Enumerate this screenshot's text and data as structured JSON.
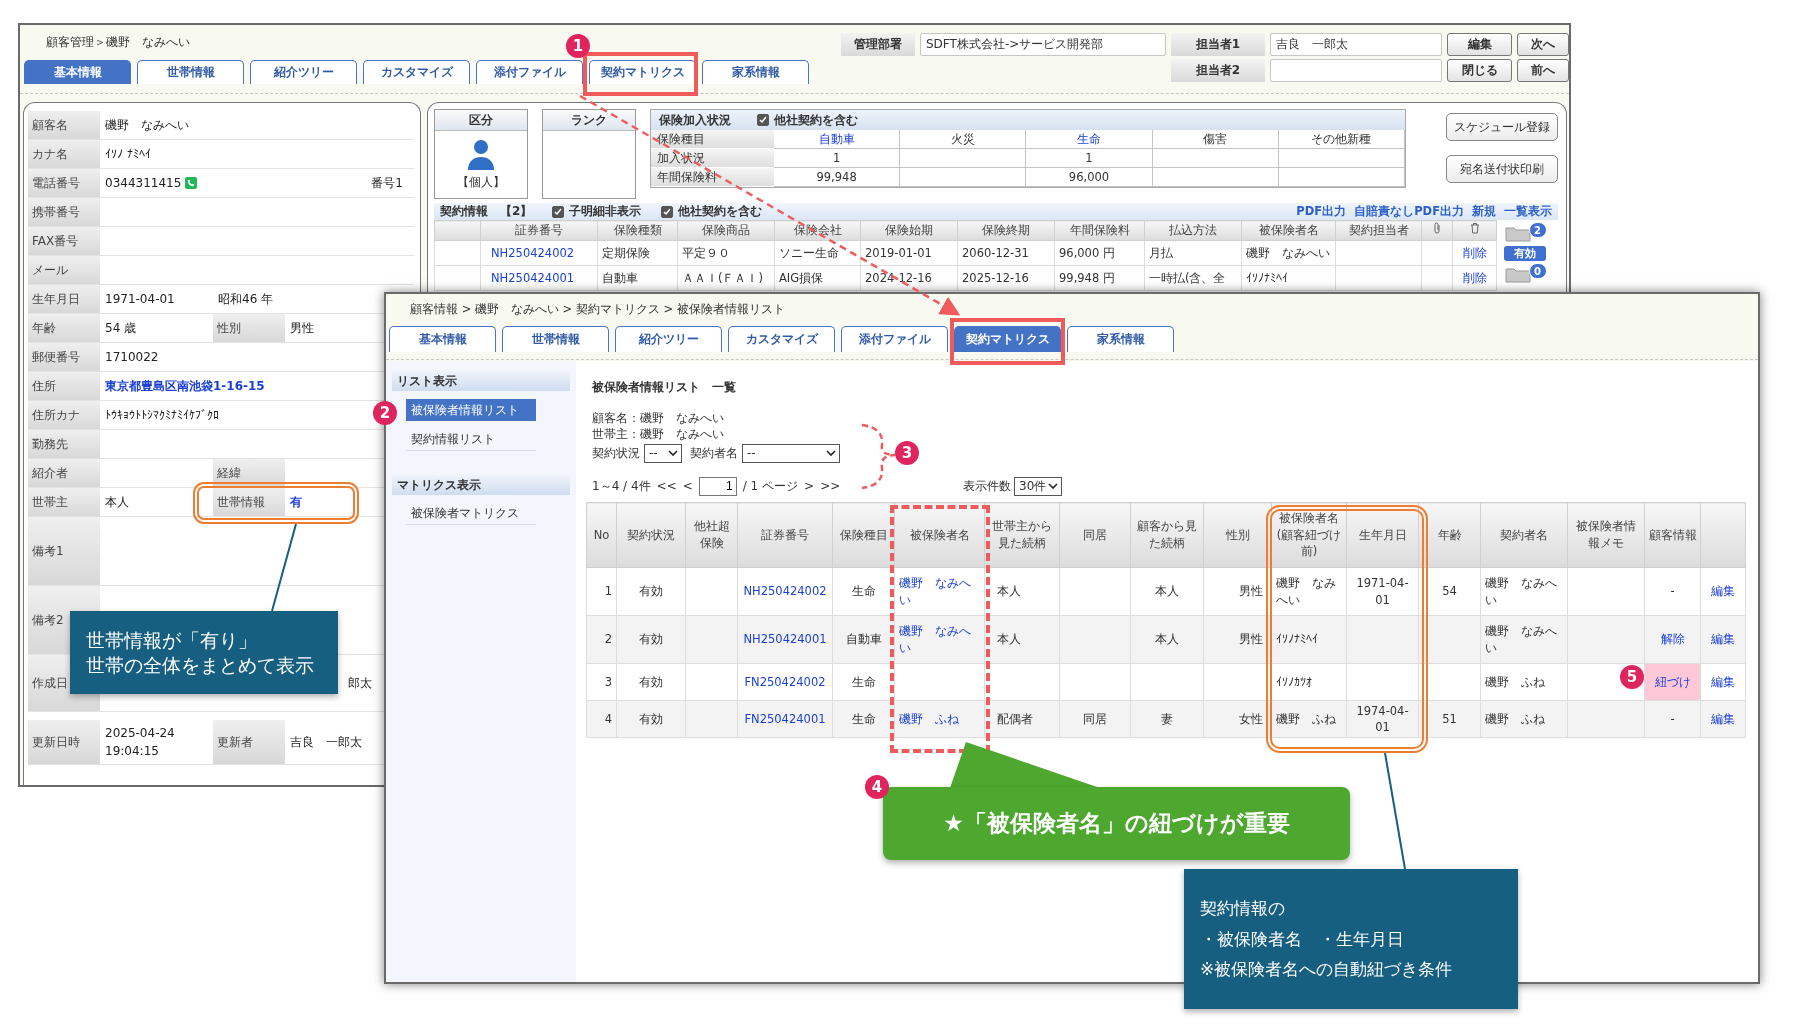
{
  "back_window": {
    "breadcrumb": "顧客管理＞磯野　なみへい",
    "header_fields": [
      {
        "label": "管理部署",
        "value": "SDFT株式会社->サービス開発部"
      },
      {
        "label": "担当者1",
        "value": "吉良　一郎太"
      },
      {
        "label": "担当者2"
      }
    ],
    "buttons": [
      "編集",
      "次へ",
      "閉じる",
      "前へ"
    ],
    "tabs": [
      {
        "label": "基本情報",
        "selected": true
      },
      {
        "label": "世帯情報",
        "selected": false
      },
      {
        "label": "紹介ツリー",
        "selected": false
      },
      {
        "label": "カスタマイズ",
        "selected": false
      },
      {
        "label": "添付ファイル",
        "selected": false
      },
      {
        "label": "契約マトリクス",
        "selected": false
      },
      {
        "label": "家系情報",
        "selected": false
      }
    ],
    "customer_rows": [
      {
        "kind": "text",
        "label": "顧客名",
        "value": "磯野　なみへい"
      },
      {
        "kind": "text",
        "label": "カナ名",
        "value": "ｲｿﾉ ﾅﾐﾍｲ"
      },
      {
        "kind": "phone",
        "label": "電話番号",
        "value": "0344311415",
        "extra": "番号1"
      },
      {
        "kind": "text",
        "label": "携帯番号"
      },
      {
        "kind": "text",
        "label": "FAX番号"
      },
      {
        "kind": "text",
        "label": "メール"
      },
      {
        "kind": "era",
        "label": "生年月日",
        "value": "1971-04-01",
        "extra": "昭和46 年"
      },
      {
        "kind": "pair",
        "cells": [
          {
            "label": "年齢",
            "value": "54 歳",
            "link": false
          },
          {
            "label": "性別",
            "value": "男性",
            "link": false
          }
        ]
      },
      {
        "kind": "text",
        "label": "郵便番号",
        "value": "1710022"
      },
      {
        "kind": "link",
        "label": "住所",
        "value": "東京都豊島区南池袋1-16-15"
      },
      {
        "kind": "text",
        "label": "住所カナ",
        "value": "ﾄｳｷｮｳﾄﾄｼﾏｸﾐﾅﾐｲｹﾌﾞｸﾛ"
      },
      {
        "kind": "text",
        "label": "勤務先"
      },
      {
        "kind": "pair",
        "cells": [
          {
            "label": "紹介者"
          },
          {
            "label": "経緯"
          }
        ]
      },
      {
        "kind": "pair",
        "cells": [
          {
            "label": "世帯主",
            "value": "本人",
            "link": false
          },
          {
            "label": "世帯情報",
            "value": "有",
            "link": true
          }
        ]
      },
      {
        "kind": "memo",
        "label": "備考1"
      },
      {
        "kind": "memo",
        "label": "備考2"
      },
      {
        "kind": "footer",
        "cells": [
          {
            "label": "作成日"
          },
          {
            "value": "郎太",
            "link": false
          }
        ]
      },
      {
        "kind": "footer",
        "cells": [
          {
            "label": "更新日時",
            "value": "2025-04-24 19:04:15",
            "link": false
          },
          {
            "label": "更新者",
            "value": "吉良　一郎太",
            "link": false
          }
        ]
      }
    ],
    "class_box": {
      "title": "区分",
      "value": "【個人】"
    },
    "rank_box": {
      "title": "ランク"
    },
    "coverage": {
      "title": "保険加入状況",
      "include_other": {
        "label": "他社契約を含む",
        "checked": true
      },
      "row_labels": [
        "保険種目",
        "加入状況",
        "年間保険料"
      ],
      "columns": [
        {
          "name": "自動車",
          "link": true,
          "count": "1",
          "premium": "99,948"
        },
        {
          "name": "火災",
          "link": false
        },
        {
          "name": "生命",
          "link": true,
          "count": "1",
          "premium": "96,000"
        },
        {
          "name": "傷害",
          "link": false
        },
        {
          "name": "その他新種",
          "link": false
        }
      ]
    },
    "side_buttons": [
      "スケジュール登録",
      "宛名送付状印刷"
    ],
    "contracts": {
      "title": "契約情報　【2】",
      "options": [
        {
          "label": "子明細非表示",
          "checked": true
        },
        {
          "label": "他社契約を含む",
          "checked": true
        }
      ],
      "links": [
        "PDF出力",
        "自賠責なしPDF出力",
        "新規",
        "一覧表示"
      ],
      "columns": [
        "証券番号",
        "保険種類",
        "保険商品",
        "保険会社",
        "保険始期",
        "保険終期",
        "年間保険料",
        "払込方法",
        "被保険者名",
        "契約担当者"
      ],
      "rows": [
        {
          "cells": [
            "NH250424002",
            "定期保険",
            "平定９０",
            "ソニー生命",
            "2019-01-01",
            "2060-12-31",
            "96,000 円",
            "月払",
            "磯野　なみへい",
            ""
          ],
          "action": "削除",
          "files": "2",
          "status": "有効"
        },
        {
          "cells": [
            "NH250424001",
            "自動車",
            "ＡＡＩ(ＦＡＩ)",
            "AIG損保",
            "2024-12-16",
            "2025-12-16",
            "99,948 円",
            "一時払(含、全",
            "ｲｿﾉﾅﾐﾍｲ",
            ""
          ],
          "action": "削除",
          "files": "0"
        }
      ]
    }
  },
  "front_window": {
    "breadcrumb": "顧客情報 > 磯野　なみへい > 契約マトリクス > 被保険者情報リスト",
    "tabs": [
      {
        "label": "基本情報",
        "selected": false
      },
      {
        "label": "世帯情報",
        "selected": false
      },
      {
        "label": "紹介ツリー",
        "selected": false
      },
      {
        "label": "カスタマイズ",
        "selected": false
      },
      {
        "label": "添付ファイル",
        "selected": false
      },
      {
        "label": "契約マトリクス",
        "selected": true
      },
      {
        "label": "家系情報",
        "selected": false
      }
    ],
    "sidebar": [
      {
        "title": "リスト表示",
        "items": [
          {
            "label": "被保険者情報リスト",
            "selected": true
          },
          {
            "label": "契約情報リスト",
            "selected": false
          }
        ]
      },
      {
        "title": "マトリクス表示",
        "items": [
          {
            "label": "被保険者マトリクス",
            "selected": false
          }
        ]
      }
    ],
    "title": "被保険者情報リスト　一覧",
    "info": [
      "顧客名：磯野　なみへい",
      "世帯主：磯野　なみへい"
    ],
    "filters": [
      {
        "label": "契約状況",
        "value": "--"
      },
      {
        "label": "契約者名",
        "value": "--"
      }
    ],
    "pagination": {
      "range": "1～4 / 4件",
      "first": "<<",
      "prev": "<",
      "page": "1",
      "total": "/ 1 ページ",
      "next": ">",
      "last": ">>"
    },
    "page_size": {
      "label": "表示件数",
      "value": "30件"
    },
    "columns": [
      "No",
      "契約状況",
      "他社超保険",
      "証券番号",
      "保険種目",
      "被保険者名",
      "世帯主から見た続柄",
      "同居",
      "顧客から見た続柄",
      "性別",
      "被保険者名(顧客紐づけ前)",
      "生年月日",
      "年齢",
      "契約者名",
      "被保険者情報メモ",
      "顧客情報"
    ],
    "rows": [
      {
        "no": "1",
        "status": "有効",
        "policy": "NH250424002",
        "type": "生命",
        "insured": "磯野　なみへい",
        "relation_head": "本人",
        "relation_customer": "本人",
        "gender": "男性",
        "insured_raw": "磯野　なみへい",
        "birth_date": "1971-04-01",
        "age": "54",
        "contractor": "磯野　なみへい",
        "customer_info": {
          "text": "-",
          "kind": "none"
        },
        "action": "編集"
      },
      {
        "no": "2",
        "status": "有効",
        "policy": "NH250424001",
        "type": "自動車",
        "insured": "磯野　なみへい",
        "relation_head": "本人",
        "relation_customer": "本人",
        "gender": "男性",
        "insured_raw": "ｲｿﾉﾅﾐﾍｲ",
        "contractor": "磯野　なみへい",
        "customer_info": {
          "text": "解除",
          "kind": "link"
        },
        "action": "編集"
      },
      {
        "no": "3",
        "status": "有効",
        "policy": "FN250424002",
        "type": "生命",
        "insured_raw": "ｲｿﾉｶﾂｵ",
        "contractor": "磯野　ふね",
        "customer_info": {
          "text": "紐づけ",
          "kind": "pending"
        },
        "action": "編集"
      },
      {
        "no": "4",
        "status": "有効",
        "policy": "FN250424001",
        "type": "生命",
        "insured": "磯野　ふね",
        "relation_head": "配偶者",
        "cohabitation": "同居",
        "relation_customer": "妻",
        "gender": "女性",
        "insured_raw": "磯野　ふね",
        "birth_date": "1974-04-01",
        "age": "51",
        "contractor": "磯野　ふね",
        "customer_info": {
          "text": "-",
          "kind": "none"
        },
        "action": "編集"
      }
    ]
  },
  "annotations": {
    "markers": [
      "1",
      "2",
      "3",
      "4",
      "5"
    ],
    "callouts": [
      {
        "kind": "note",
        "lines": [
          "世帯情報が「有り」",
          "世帯の全体をまとめて表示"
        ]
      },
      {
        "kind": "banner",
        "lines": [
          "★「被保険者名」の紐づけが重要"
        ]
      },
      {
        "kind": "note",
        "lines": [
          "契約情報の",
          "・被保険者名　・生年月日",
          "※被保険者名への自動紐づき条件"
        ]
      }
    ]
  }
}
